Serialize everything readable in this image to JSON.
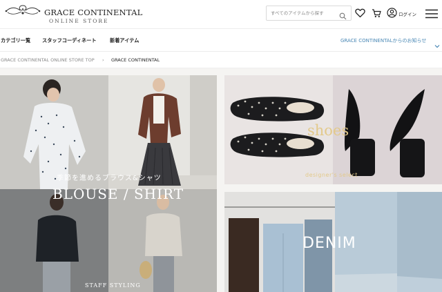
{
  "header": {
    "brand_name": "GRACE CONTINENTAL",
    "brand_sub": "ONLINE STORE",
    "search_placeholder": "すべてのアイテムから探す",
    "login_label": "ログイン"
  },
  "nav": {
    "items": [
      {
        "label": "カテゴリ一覧"
      },
      {
        "label": "スタッフコーディネート"
      },
      {
        "label": "新着アイテム"
      }
    ],
    "notice": "GRACE CONTINENTALからのお知らせ"
  },
  "breadcrumb": {
    "items": [
      {
        "label": "GRACE CONTINENTAL ONLINE STORE TOP"
      },
      {
        "label": "GRACE CONTINENTAL"
      }
    ],
    "separator": "›"
  },
  "banners": {
    "blouse": {
      "subtitle": "季節を進めるブラウス&シャツ",
      "title": "BLOUSE / SHIRT",
      "caption": "STAFF STYLING"
    },
    "shoes": {
      "title": "shoes",
      "caption": "designer's select"
    },
    "denim": {
      "title": "DENIM"
    }
  },
  "colors": {
    "accent": "#4a88b5",
    "text": "#222222",
    "muted": "#888888",
    "gold": "#e3c98a"
  }
}
